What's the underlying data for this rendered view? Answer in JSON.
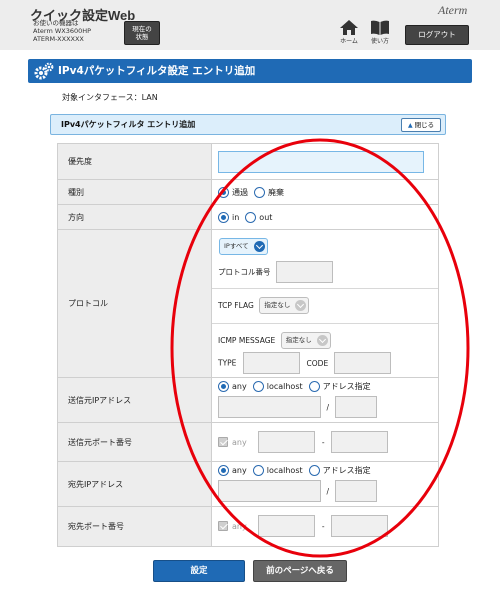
{
  "header": {
    "app_title": "クイック設定Web",
    "device_caption": "お使いの機器は",
    "device_model": "Aterm WX3600HP",
    "device_name": "ATERM-XXXXXX",
    "status_button": "現在の\n状態",
    "logo": "Aterm",
    "home_label": "ホーム",
    "help_label": "使い方",
    "logout_label": "ログアウト"
  },
  "page_title": "IPv4パケットフィルタ設定 エントリ追加",
  "interface_label": "対象インタフェース：LAN",
  "section": {
    "title": "IPv4パケットフィルタ エントリ追加",
    "close_label": "閉じる"
  },
  "form": {
    "priority": {
      "label": "優先度",
      "value": ""
    },
    "type": {
      "label": "種別",
      "options": [
        "通過",
        "廃棄"
      ],
      "selected": "通過"
    },
    "direction": {
      "label": "方向",
      "options": [
        "in",
        "out"
      ],
      "selected": "in"
    },
    "protocol": {
      "label": "プロトコル",
      "select_value": "IPすべて",
      "number_label": "プロトコル番号",
      "tcp_flag_label": "TCP FLAG",
      "tcp_flag_value": "指定なし",
      "icmp_label": "ICMP MESSAGE",
      "icmp_value": "指定なし",
      "type_label": "TYPE",
      "code_label": "CODE"
    },
    "src_ip": {
      "label": "送信元IPアドレス",
      "options": [
        "any",
        "localhost",
        "アドレス指定"
      ],
      "selected": "any",
      "slash": "/"
    },
    "src_port": {
      "label": "送信元ポート番号",
      "any_label": "any",
      "dash": "-"
    },
    "dst_ip": {
      "label": "宛先IPアドレス",
      "options": [
        "any",
        "localhost",
        "アドレス指定"
      ],
      "selected": "any",
      "slash": "/"
    },
    "dst_port": {
      "label": "宛先ポート番号",
      "any_label": "any",
      "dash": "-"
    }
  },
  "buttons": {
    "submit": "設定",
    "back": "前のページへ戻る"
  },
  "colors": {
    "accent": "#1f6ab5",
    "annotation": "#e8000b"
  },
  "icons": [
    "gear-icon",
    "home-icon",
    "book-icon",
    "chevron-up-icon",
    "chevron-down-icon"
  ]
}
